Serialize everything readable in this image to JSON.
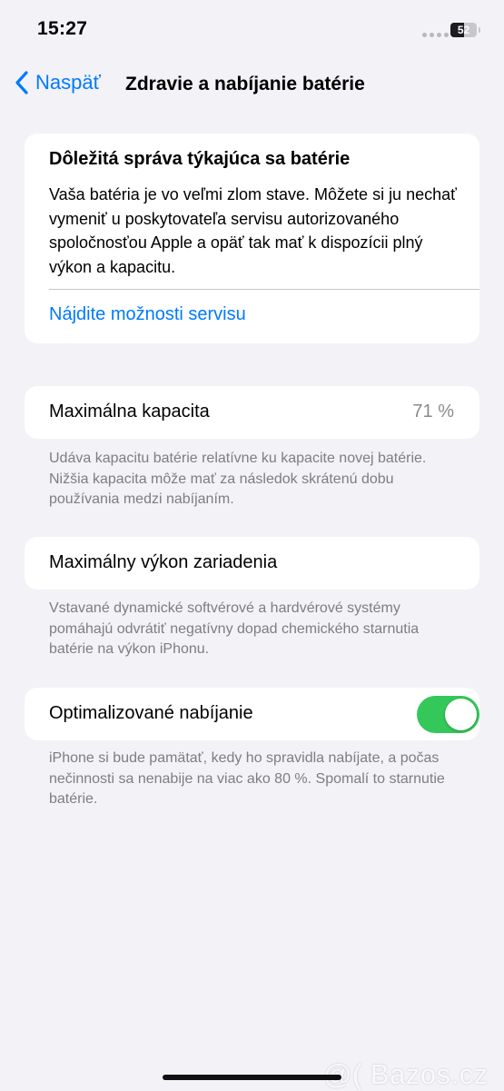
{
  "status_bar": {
    "time": "15:27",
    "battery_level": 52,
    "battery_text": "52"
  },
  "nav": {
    "back_label": "Naspäť",
    "title": "Zdravie a nabíjanie batérie"
  },
  "notice": {
    "title": "Dôležitá správa týkajúca sa batérie",
    "body": "Vaša batéria je vo veľmi zlom stave. Môžete si ju nechať vymeniť u poskytovateľa servisu autorizovaného spoločnosťou Apple a opäť tak mať k dispozícii plný výkon a kapacitu.",
    "link": "Nájdite možnosti servisu"
  },
  "capacity": {
    "label": "Maximálna kapacita",
    "value": "71 %",
    "footer": "Udáva kapacitu batérie relatívne ku kapacite novej batérie. Nižšia kapacita môže mať za následok skrátenú dobu používania medzi nabíjaním."
  },
  "performance": {
    "label": "Maximálny výkon zariadenia",
    "footer": "Vstavané dynamické softvérové a hardvérové systémy pomáhajú odvrátiť negatívny dopad chemického starnutia batérie na výkon iPhonu."
  },
  "optimized_charging": {
    "label": "Optimalizované nabíjanie",
    "enabled": true,
    "footer": "iPhone si bude pamätať, kedy ho spravidla nabíjate, a počas nečinnosti sa nenabije na viac ako 80 %. Spomalí to starnutie batérie."
  },
  "watermark": "@( Bazos.cz",
  "colors": {
    "accent": "#007aff",
    "toggle_on": "#34c759",
    "background": "#f2f2f7",
    "secondary_text": "#8a8a8e"
  }
}
